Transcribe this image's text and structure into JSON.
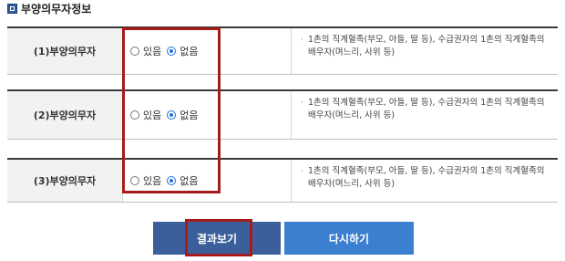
{
  "section": {
    "title": "부양의무자정보",
    "icon": "section-icon"
  },
  "rows": [
    {
      "label": "(1)부양의무자",
      "option_yes": "있음",
      "option_no": "없음",
      "selected": "no",
      "desc": "1촌의 직계혈족(부모, 아들, 딸 등), 수급권자의 1촌의 직계혈족의 배우자(며느리, 사위 등)"
    },
    {
      "label": "(2)부양의무자",
      "option_yes": "있음",
      "option_no": "없음",
      "selected": "no",
      "desc": "1촌의 직계혈족(부모, 아들, 딸 등), 수급권자의 1촌의 직계혈족의 배우자(며느리, 사위 등)"
    },
    {
      "label": "(3)부양의무자",
      "option_yes": "있음",
      "option_no": "없음",
      "selected": "no",
      "desc": "1촌의 직계혈족(부모, 아들, 딸 등), 수급권자의 1촌의 직계혈족의 배우자(며느리, 사위 등)"
    }
  ],
  "buttons": {
    "result": "결과보기",
    "reset": "다시하기"
  },
  "colors": {
    "highlight": "#a61c1c",
    "result_button": "#3b5f9a",
    "reset_button": "#3a7fd0",
    "radio_checked": "#1a73d9"
  }
}
